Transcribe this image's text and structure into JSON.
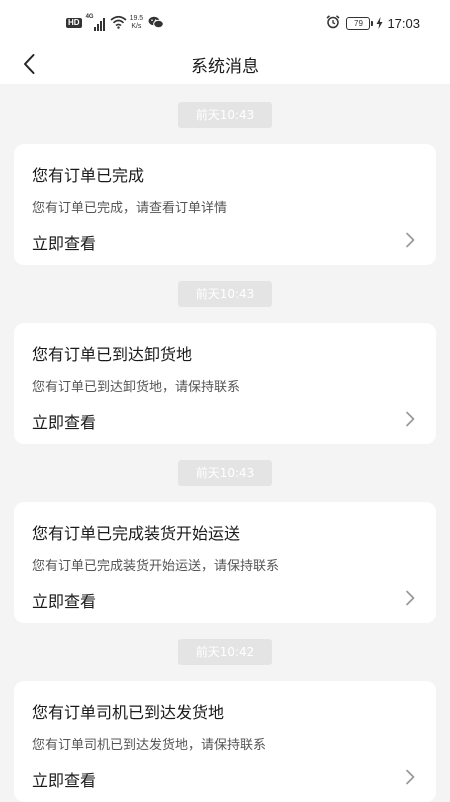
{
  "status_bar": {
    "hd": "HD",
    "network": "4G",
    "speed_value": "19.5",
    "speed_unit": "K/s",
    "battery": "79",
    "time": "17:03",
    "icons": [
      "hd-icon",
      "signal-icon",
      "wifi-icon",
      "wechat-icon",
      "alarm-icon",
      "battery-icon",
      "charging-bolt-icon"
    ]
  },
  "header": {
    "title": "系统消息",
    "back_icon": "chevron-left-icon"
  },
  "messages": [
    {
      "time": "前天10:43",
      "title": "您有订单已完成",
      "desc": "您有订单已完成，请查看订单详情",
      "action": "立即查看"
    },
    {
      "time": "前天10:43",
      "title": "您有订单已到达卸货地",
      "desc": "您有订单已到达卸货地，请保持联系",
      "action": "立即查看"
    },
    {
      "time": "前天10:43",
      "title": "您有订单已完成装货开始运送",
      "desc": "您有订单已完成装货开始运送，请保持联系",
      "action": "立即查看"
    },
    {
      "time": "前天10:42",
      "title": "您有订单司机已到达发货地",
      "desc": "您有订单司机已到达发货地，请保持联系",
      "action": "立即查看"
    }
  ],
  "colors": {
    "background": "#f4f4f4",
    "card": "#ffffff",
    "time_pill": "#e4e4e4",
    "text_primary": "#1a1a1a",
    "text_secondary": "#555555",
    "chevron": "#999999"
  }
}
